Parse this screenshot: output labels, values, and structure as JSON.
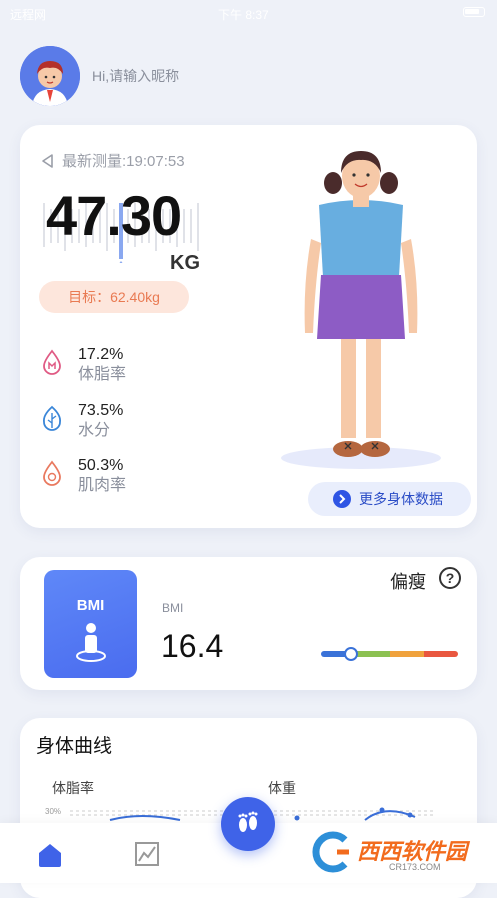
{
  "status_bar": {
    "carrier": "远程网",
    "time": "下午 8:37"
  },
  "greeting": {
    "text": "Hi,请输入昵称"
  },
  "measurement": {
    "latest_label": "最新测量:19:07:53",
    "weight": "47.30",
    "unit": "KG",
    "target": "目标：62.40kg"
  },
  "metrics": [
    {
      "value": "17.2%",
      "label": "体脂率",
      "icon": "body-fat-drop-icon",
      "color": "#e05a84"
    },
    {
      "value": "73.5%",
      "label": "水分",
      "icon": "water-leaf-icon",
      "color": "#3a86d8"
    },
    {
      "value": "50.3%",
      "label": "肌肉率",
      "icon": "muscle-drop-icon",
      "color": "#e9795f"
    }
  ],
  "more_button": {
    "label": "更多身体数据"
  },
  "bmi": {
    "box_title": "BMI",
    "small_label": "BMI",
    "value": "16.4",
    "status": "偏瘦",
    "help": "?",
    "scale_colors": [
      "#3a72d8",
      "#8cc152",
      "#f0a23c",
      "#e9573f"
    ],
    "scale_position": 0.22
  },
  "curve": {
    "title": "身体曲线",
    "sub_left": "体脂率",
    "sub_right": "体重",
    "tick": "30%"
  },
  "tabbar": {
    "home_icon": "home-icon",
    "chart_icon": "chart-icon",
    "fab_icon": "footprints-icon"
  },
  "watermark": {
    "text": "西西软件园",
    "sub": "CR173.COM"
  },
  "colors": {
    "accent": "#3f63e8",
    "target_bg": "#fde6dc",
    "target_text": "#e97a52"
  }
}
